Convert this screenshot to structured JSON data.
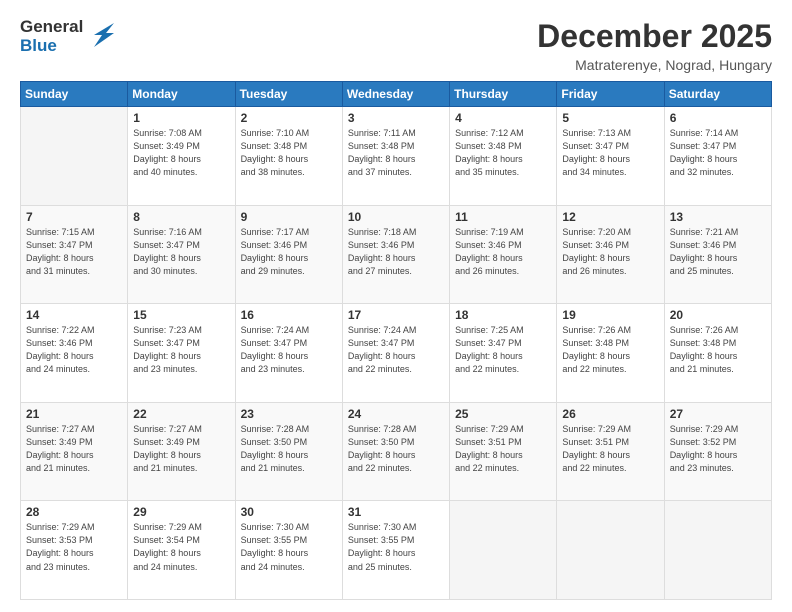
{
  "logo": {
    "general": "General",
    "blue": "Blue"
  },
  "header": {
    "month": "December 2025",
    "location": "Matraterenye, Nograd, Hungary"
  },
  "weekdays": [
    "Sunday",
    "Monday",
    "Tuesday",
    "Wednesday",
    "Thursday",
    "Friday",
    "Saturday"
  ],
  "weeks": [
    [
      {
        "day": "",
        "info": ""
      },
      {
        "day": "1",
        "info": "Sunrise: 7:08 AM\nSunset: 3:49 PM\nDaylight: 8 hours\nand 40 minutes."
      },
      {
        "day": "2",
        "info": "Sunrise: 7:10 AM\nSunset: 3:48 PM\nDaylight: 8 hours\nand 38 minutes."
      },
      {
        "day": "3",
        "info": "Sunrise: 7:11 AM\nSunset: 3:48 PM\nDaylight: 8 hours\nand 37 minutes."
      },
      {
        "day": "4",
        "info": "Sunrise: 7:12 AM\nSunset: 3:48 PM\nDaylight: 8 hours\nand 35 minutes."
      },
      {
        "day": "5",
        "info": "Sunrise: 7:13 AM\nSunset: 3:47 PM\nDaylight: 8 hours\nand 34 minutes."
      },
      {
        "day": "6",
        "info": "Sunrise: 7:14 AM\nSunset: 3:47 PM\nDaylight: 8 hours\nand 32 minutes."
      }
    ],
    [
      {
        "day": "7",
        "info": "Sunrise: 7:15 AM\nSunset: 3:47 PM\nDaylight: 8 hours\nand 31 minutes."
      },
      {
        "day": "8",
        "info": "Sunrise: 7:16 AM\nSunset: 3:47 PM\nDaylight: 8 hours\nand 30 minutes."
      },
      {
        "day": "9",
        "info": "Sunrise: 7:17 AM\nSunset: 3:46 PM\nDaylight: 8 hours\nand 29 minutes."
      },
      {
        "day": "10",
        "info": "Sunrise: 7:18 AM\nSunset: 3:46 PM\nDaylight: 8 hours\nand 27 minutes."
      },
      {
        "day": "11",
        "info": "Sunrise: 7:19 AM\nSunset: 3:46 PM\nDaylight: 8 hours\nand 26 minutes."
      },
      {
        "day": "12",
        "info": "Sunrise: 7:20 AM\nSunset: 3:46 PM\nDaylight: 8 hours\nand 26 minutes."
      },
      {
        "day": "13",
        "info": "Sunrise: 7:21 AM\nSunset: 3:46 PM\nDaylight: 8 hours\nand 25 minutes."
      }
    ],
    [
      {
        "day": "14",
        "info": "Sunrise: 7:22 AM\nSunset: 3:46 PM\nDaylight: 8 hours\nand 24 minutes."
      },
      {
        "day": "15",
        "info": "Sunrise: 7:23 AM\nSunset: 3:47 PM\nDaylight: 8 hours\nand 23 minutes."
      },
      {
        "day": "16",
        "info": "Sunrise: 7:24 AM\nSunset: 3:47 PM\nDaylight: 8 hours\nand 23 minutes."
      },
      {
        "day": "17",
        "info": "Sunrise: 7:24 AM\nSunset: 3:47 PM\nDaylight: 8 hours\nand 22 minutes."
      },
      {
        "day": "18",
        "info": "Sunrise: 7:25 AM\nSunset: 3:47 PM\nDaylight: 8 hours\nand 22 minutes."
      },
      {
        "day": "19",
        "info": "Sunrise: 7:26 AM\nSunset: 3:48 PM\nDaylight: 8 hours\nand 22 minutes."
      },
      {
        "day": "20",
        "info": "Sunrise: 7:26 AM\nSunset: 3:48 PM\nDaylight: 8 hours\nand 21 minutes."
      }
    ],
    [
      {
        "day": "21",
        "info": "Sunrise: 7:27 AM\nSunset: 3:49 PM\nDaylight: 8 hours\nand 21 minutes."
      },
      {
        "day": "22",
        "info": "Sunrise: 7:27 AM\nSunset: 3:49 PM\nDaylight: 8 hours\nand 21 minutes."
      },
      {
        "day": "23",
        "info": "Sunrise: 7:28 AM\nSunset: 3:50 PM\nDaylight: 8 hours\nand 21 minutes."
      },
      {
        "day": "24",
        "info": "Sunrise: 7:28 AM\nSunset: 3:50 PM\nDaylight: 8 hours\nand 22 minutes."
      },
      {
        "day": "25",
        "info": "Sunrise: 7:29 AM\nSunset: 3:51 PM\nDaylight: 8 hours\nand 22 minutes."
      },
      {
        "day": "26",
        "info": "Sunrise: 7:29 AM\nSunset: 3:51 PM\nDaylight: 8 hours\nand 22 minutes."
      },
      {
        "day": "27",
        "info": "Sunrise: 7:29 AM\nSunset: 3:52 PM\nDaylight: 8 hours\nand 23 minutes."
      }
    ],
    [
      {
        "day": "28",
        "info": "Sunrise: 7:29 AM\nSunset: 3:53 PM\nDaylight: 8 hours\nand 23 minutes."
      },
      {
        "day": "29",
        "info": "Sunrise: 7:29 AM\nSunset: 3:54 PM\nDaylight: 8 hours\nand 24 minutes."
      },
      {
        "day": "30",
        "info": "Sunrise: 7:30 AM\nSunset: 3:55 PM\nDaylight: 8 hours\nand 24 minutes."
      },
      {
        "day": "31",
        "info": "Sunrise: 7:30 AM\nSunset: 3:55 PM\nDaylight: 8 hours\nand 25 minutes."
      },
      {
        "day": "",
        "info": ""
      },
      {
        "day": "",
        "info": ""
      },
      {
        "day": "",
        "info": ""
      }
    ]
  ]
}
